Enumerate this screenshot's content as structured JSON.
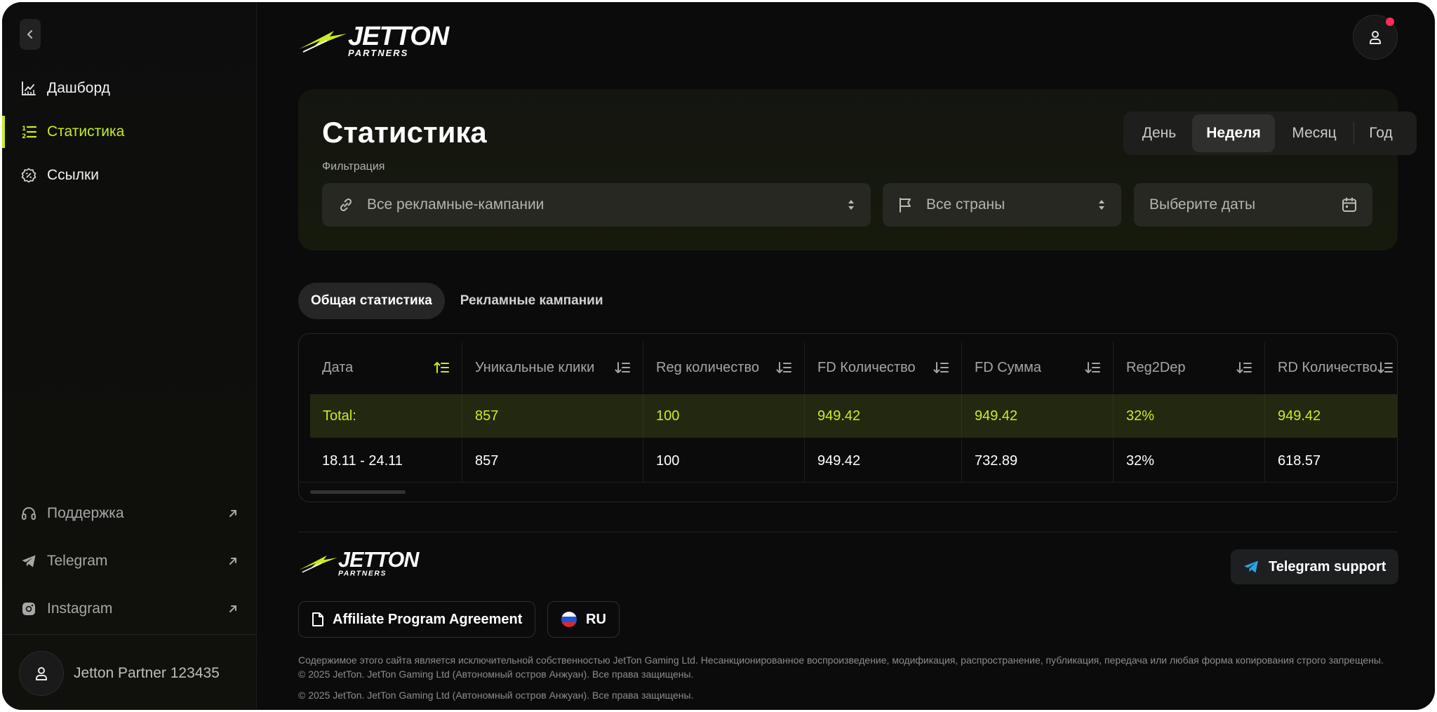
{
  "brand": {
    "logo_main": "JETTON",
    "logo_sub": "PARTNERS",
    "accent": "#c6ee22",
    "background": "#0b0b0b"
  },
  "sidebar": {
    "collapse_icon": "chevron-left-icon",
    "nav": [
      {
        "label": "Дашборд",
        "icon": "chart-line-icon",
        "active": false
      },
      {
        "label": "Статистика",
        "icon": "numbered-list-icon",
        "active": true
      },
      {
        "label": "Ссылки",
        "icon": "badge-percent-icon",
        "active": false
      }
    ],
    "external": [
      {
        "label": "Поддержка",
        "icon": "headset-icon"
      },
      {
        "label": "Telegram",
        "icon": "telegram-icon"
      },
      {
        "label": "Instagram",
        "icon": "instagram-icon"
      }
    ],
    "profile": {
      "name": "Jetton Partner 123435",
      "icon": "user-icon"
    }
  },
  "header": {
    "avatar_icon": "user-icon",
    "has_notification": true
  },
  "stats": {
    "title": "Статистика",
    "filter_label": "Фильтрация",
    "periods": [
      "День",
      "Неделя",
      "Месяц",
      "Год"
    ],
    "active_period": "Неделя",
    "campaign_select": {
      "value": "Все рекламные-кампании",
      "icon": "link-icon"
    },
    "country_select": {
      "value": "Все страны",
      "icon": "flag-icon"
    },
    "date_picker": {
      "placeholder": "Выберите даты",
      "icon": "calendar-icon"
    }
  },
  "tabs": [
    {
      "label": "Общая статистика",
      "active": true
    },
    {
      "label": "Рекламные кампании",
      "active": false
    }
  ],
  "table": {
    "columns": [
      "Дата",
      "Уникальные клики",
      "Reg количество",
      "FD Количество",
      "FD Сумма",
      "Reg2Dep",
      "RD Количество"
    ],
    "total": [
      "Total:",
      "857",
      "100",
      "949.42",
      "949.42",
      "32%",
      "949.42"
    ],
    "rows": [
      [
        "18.11 - 24.11",
        "857",
        "100",
        "949.42",
        "732.89",
        "32%",
        "618.57"
      ]
    ]
  },
  "footer": {
    "telegram_support": "Telegram support",
    "agreement": "Affiliate Program Agreement",
    "language": "RU",
    "legal": "Содержимое этого сайта является исключительной собственностью JetTon Gaming Ltd. Несанкционированное воспроизведение, модификация, распространение, публикация, передача или любая форма копирования строго запрещены. © 2025 JetTon. JetTon Gaming Ltd (Автономный остров Анжуан). Все права защищены.",
    "copyright": "© 2025 JetTon. JetTon Gaming Ltd (Автономный остров Анжуан). Все права защищены."
  }
}
